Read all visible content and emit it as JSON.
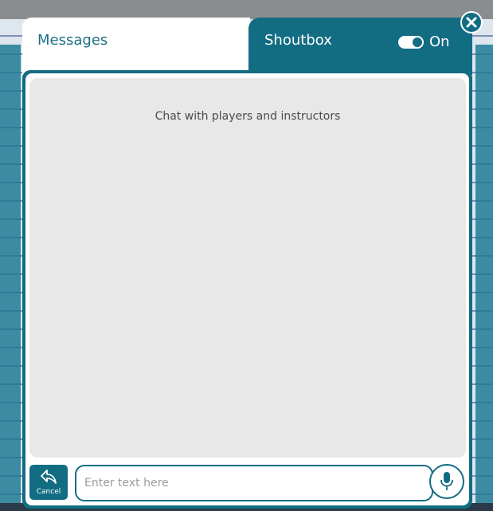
{
  "tabs": {
    "messages_label": "Messages",
    "shoutbox_label": "Shoutbox"
  },
  "shoutbox_toggle": {
    "state_label": "On",
    "enabled": true
  },
  "message_area": {
    "empty_hint": "Chat with players and instructors"
  },
  "composer": {
    "cancel_label": "Cancel",
    "placeholder": "Enter text here"
  },
  "icons": {
    "close": "close-icon",
    "cancel": "reply-arrow-icon",
    "mic": "microphone-icon"
  },
  "colors": {
    "accent": "#126d83",
    "message_area_bg": "#e8e8e8",
    "tab_inactive_text": "#1b6f86"
  }
}
